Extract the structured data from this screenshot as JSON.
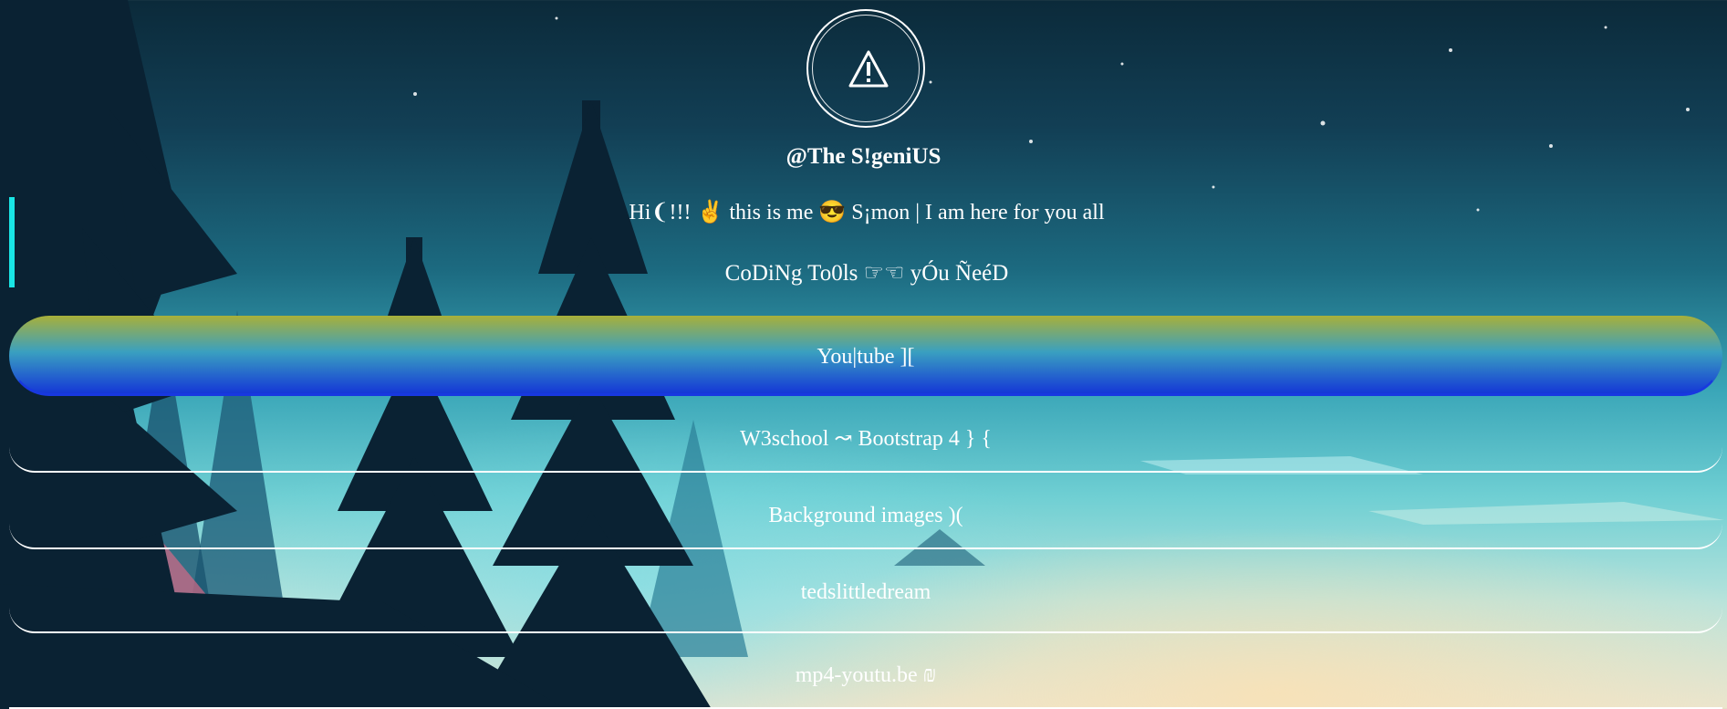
{
  "profile": {
    "avatar_icon": "warning-triangle-icon",
    "handle": "@The S!geniUS",
    "bio": "Hi❨!!! ✌️ this is me 😎 S¡mon | I am here for you all",
    "tools_heading": "CoDiNg To0ls ☞☜ yÓu ÑeéD"
  },
  "links": [
    {
      "label": "You|tube ]["
    },
    {
      "label": "W3school ↝ Bootstrap 4 } {"
    },
    {
      "label": "Background images )("
    },
    {
      "label": "tedslittledream"
    },
    {
      "label": "mp4-youtu.be ₪"
    }
  ],
  "colors": {
    "accent_bar": "#19e5e5",
    "active_border_top": "#a8b03a",
    "active_border_bottom": "#1230d8"
  }
}
